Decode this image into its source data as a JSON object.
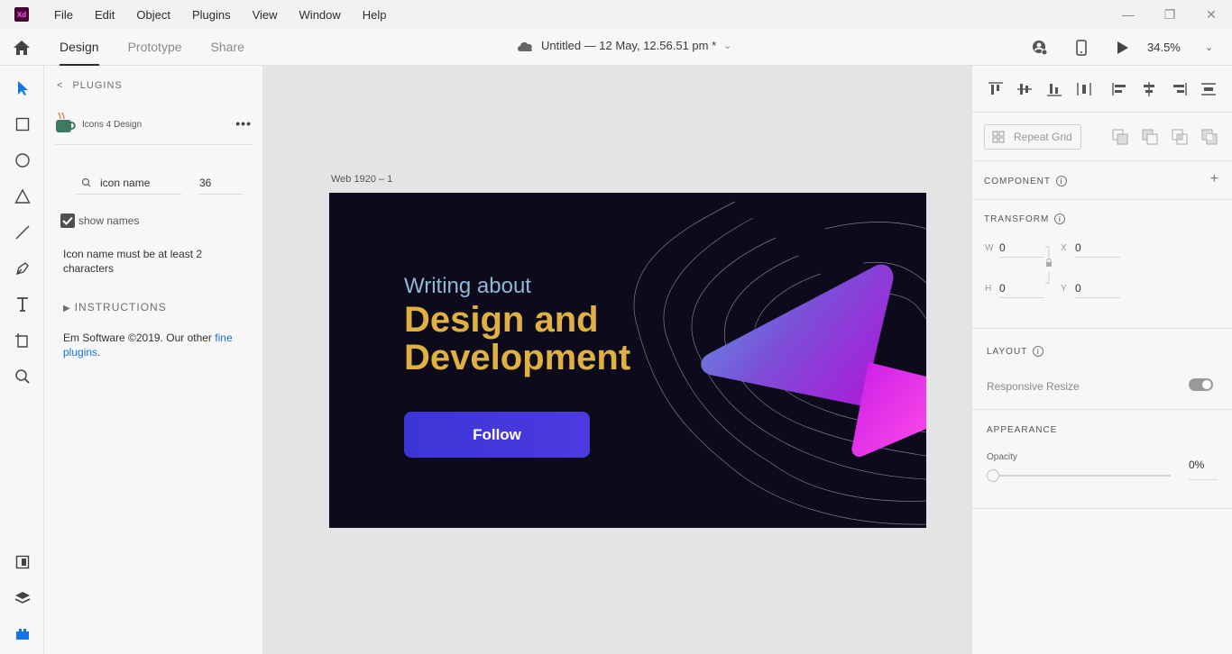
{
  "app": {
    "logo": "Xd"
  },
  "menu": [
    "File",
    "Edit",
    "Object",
    "Plugins",
    "View",
    "Window",
    "Help"
  ],
  "window_controls": {
    "minimize": "—",
    "restore": "❐",
    "close": "✕"
  },
  "toolbar": {
    "tabs": [
      {
        "label": "Design",
        "active": true
      },
      {
        "label": "Prototype",
        "active": false
      },
      {
        "label": "Share",
        "active": false
      }
    ],
    "doc_title": "Untitled — 12 May, 12.56.51 pm *",
    "zoom": "34.5%"
  },
  "tools": [
    "select-icon",
    "rectangle-icon",
    "ellipse-icon",
    "polygon-icon",
    "line-icon",
    "pen-icon",
    "text-icon",
    "artboard-icon",
    "zoom-icon",
    "assets-icon",
    "layers-icon",
    "plugins-icon"
  ],
  "plugins": {
    "header": "PLUGINS",
    "plugin_name": "Icons 4 Design",
    "search": {
      "value": "icon name",
      "placeholder": "icon name"
    },
    "size": "36",
    "show_names": {
      "label": "show names",
      "checked": true
    },
    "note": "Icon name must be at least 2 characters",
    "instructions": "INSTRUCTIONS",
    "copyright": "Em Software ©2019. Our other ",
    "link": "fine plugins",
    "period": "."
  },
  "canvas": {
    "artboard_label": "Web 1920 – 1",
    "subtitle": "Writing about",
    "title_line1": "Design and",
    "title_line2": "Development",
    "button": "Follow",
    "colors": {
      "background": "#0d0a1c",
      "subtitle": "#8fb9d6",
      "title": "#e0b040",
      "button": "#4038dc"
    }
  },
  "properties": {
    "repeat_grid": "Repeat Grid",
    "component": "COMPONENT",
    "transform": "TRANSFORM",
    "w_label": "W",
    "w": "0",
    "x_label": "X",
    "x": "0",
    "h_label": "H",
    "h": "0",
    "y_label": "Y",
    "y": "0",
    "layout": "LAYOUT",
    "responsive_resize": "Responsive Resize",
    "appearance": "APPEARANCE",
    "opacity_label": "Opacity",
    "opacity": "0%"
  }
}
